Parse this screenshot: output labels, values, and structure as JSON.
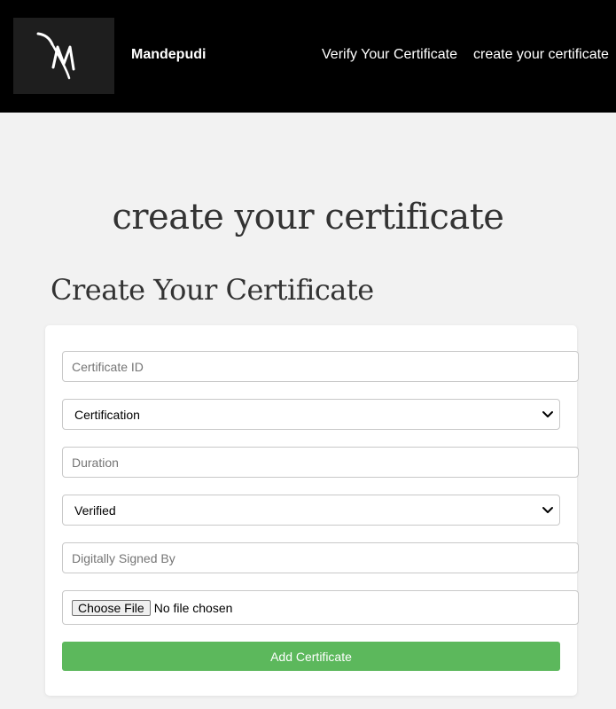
{
  "header": {
    "brand": "Mandepudi",
    "logo_icon": "m-monogram-icon",
    "nav": {
      "verify": "Verify Your Certificate",
      "create": "create your certificate"
    }
  },
  "page": {
    "heading": "create your certificate"
  },
  "form": {
    "heading": "Create Your Certificate",
    "certificate_id_placeholder": "Certificate ID",
    "certification_selected": "Certification",
    "duration_placeholder": "Duration",
    "verified_selected": "Verified",
    "signed_by_placeholder": "Digitally Signed By",
    "file": {
      "button": "Choose File",
      "status": "No file chosen"
    },
    "submit": "Add Certificate"
  },
  "colors": {
    "header_bg": "#000000",
    "page_bg": "#f2f2f2",
    "submit_bg": "#5cb85c"
  }
}
